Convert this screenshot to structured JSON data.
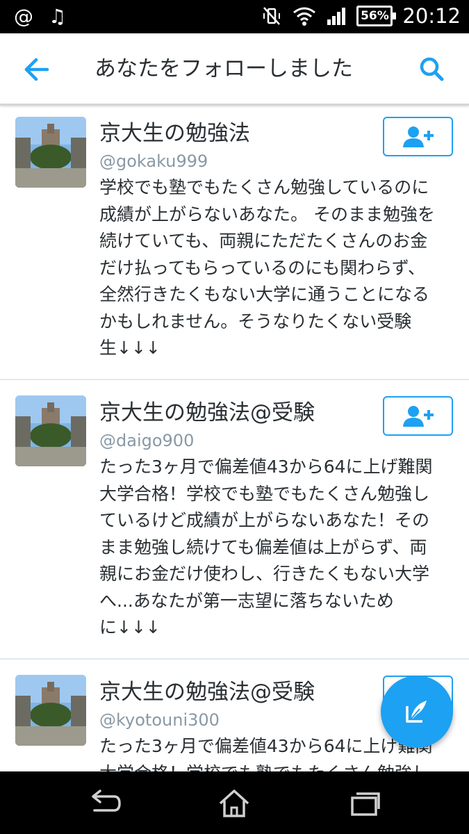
{
  "status_bar": {
    "left_icons": [
      "at-sign-icon",
      "music-note-icon"
    ],
    "at_symbol": "@",
    "music_symbol": "♫",
    "right_icons": [
      "vibrate-mute-icon",
      "wifi-icon",
      "signal-icon",
      "battery-icon"
    ],
    "battery_level": "56%",
    "time": "20:12"
  },
  "app_bar": {
    "title": "あなたをフォローしました",
    "back_icon": "arrow-left-icon",
    "search_icon": "search-icon",
    "accent_color": "#1da1f2"
  },
  "users": [
    {
      "display_name": "京大生の勉強法",
      "handle": "@gokaku999",
      "bio_lines": [
        "学校でも塾でもたくさん勉強しているのに",
        "成績が上がらないあなた。 そのまま勉強を",
        "続けていても、両親にただたくさんのお金",
        "だけ払ってもらっているのにも関わらず、",
        "全然行きたくもない大学に通うことになる",
        "かもしれません。そうなりたくない受験",
        "生↓↓↓"
      ],
      "follow_icon": "add-user-icon"
    },
    {
      "display_name": "京大生の勉強法@受験",
      "handle": "@daigo900",
      "bio_lines": [
        "たった3ヶ月で偏差値43から64に上げ難関",
        "大学合格！学校でも塾でもたくさん勉強し",
        "ているけど成績が上がらないあなた！その",
        "まま勉強し続けても偏差値は上がらず、両",
        "親にお金だけ使わし、行きたくもない大学",
        "へ...あなたが第一志望に落ちないため",
        "に↓↓↓"
      ],
      "follow_icon": "add-user-icon"
    },
    {
      "display_name": "京大生の勉強法@受験",
      "handle": "@kyotouni300",
      "bio_lines": [
        "たった3ヶ月で偏差値43から64に上げ難関",
        "大学合格！学校でも塾でもたくさん勉強し"
      ],
      "follow_icon": "add-user-icon"
    }
  ],
  "fab": {
    "icon": "compose-tweet-icon"
  },
  "nav_bar": {
    "icons": [
      "back-nav-icon",
      "home-nav-icon",
      "recents-nav-icon"
    ]
  }
}
